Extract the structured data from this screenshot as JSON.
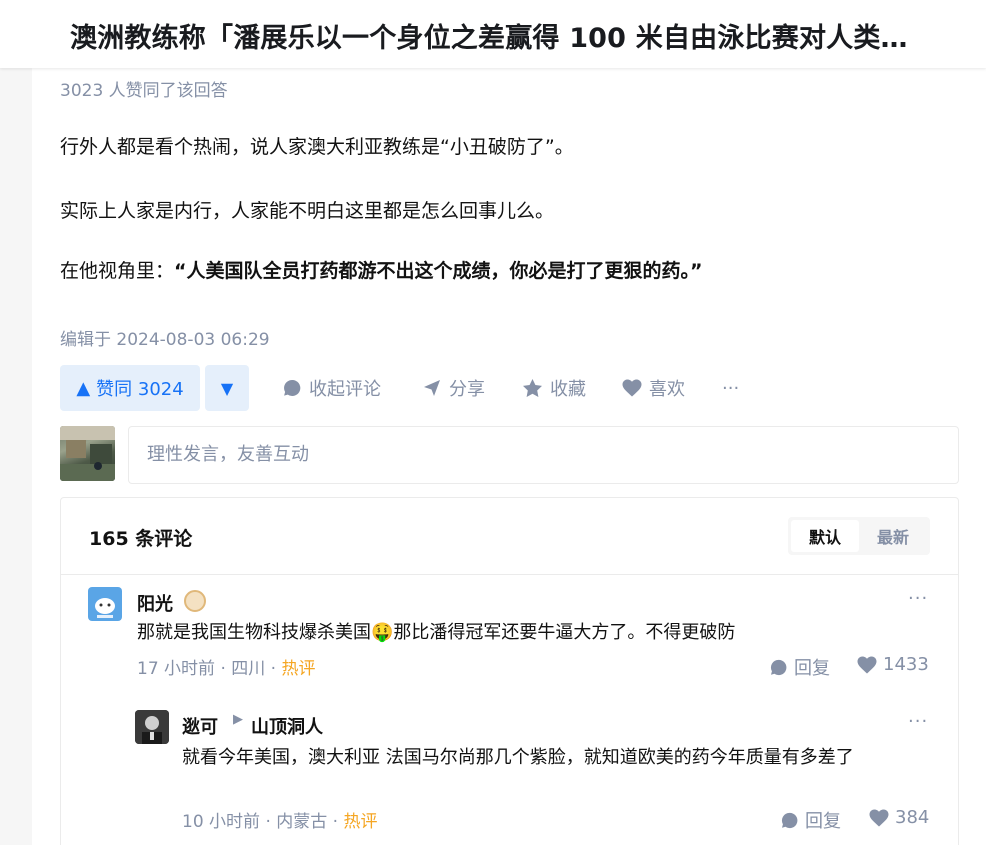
{
  "header": {
    "title": "澳洲教练称「潘展乐以一个身位之差赢得 100 米自由泳比赛对人类…"
  },
  "answer": {
    "voters": "3023 人赞同了该回答",
    "paragraphs": [
      "行外人都是看个热闹，说人家澳大利亚教练是“小丑破防了”。",
      "实际上人家是内行，人家能不明白这里都是怎么回事儿么。"
    ],
    "p3_prefix": "在他视角里：",
    "p3_bold": "“人美国队全员打药都游不出这个成绩，你必是打了更狠的药。”",
    "edited": "编辑于 2024-08-03 06:29"
  },
  "actions": {
    "upvote": "赞同 3024",
    "collapse_comments": "收起评论",
    "share": "分享",
    "favorite": "收藏",
    "like": "喜欢",
    "more": "···"
  },
  "comment_input": {
    "placeholder": "理性发言，友善互动"
  },
  "comments": {
    "count": "165 条评论",
    "sort": [
      "默认",
      "最新"
    ],
    "items": [
      {
        "author": "阳光",
        "text": "那就是我国生物科技爆杀美国🤑那比潘得冠军还要牛逼大方了。不得更破防",
        "time": "17 小时前",
        "location": "四川",
        "tag": "热评",
        "reply": "回复",
        "likes": "1433"
      },
      {
        "author": "逖可",
        "reply_to": "山顶洞人",
        "text": "就看今年美国，澳大利亚 法国马尔尚那几个紫脸，就知道欧美的药今年质量有多差了",
        "time": "10 小时前",
        "location": "内蒙古",
        "tag": "热评",
        "reply": "回复",
        "likes": "384"
      }
    ]
  },
  "colors": {
    "accent": "#1772f6",
    "hot": "#f5a623",
    "muted": "#8590a6"
  }
}
